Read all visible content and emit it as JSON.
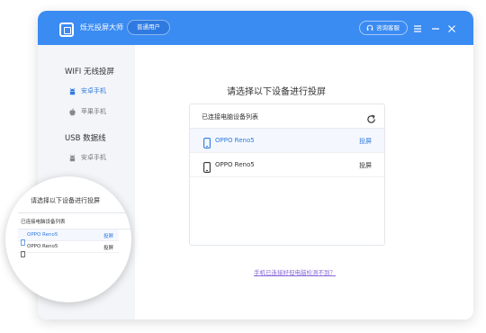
{
  "titlebar": {
    "app_title": "烁光投屏大师",
    "user_badge": "普通用户",
    "support_label": "咨询客服"
  },
  "sidebar": {
    "wifi_section": "WIFI 无线投屏",
    "wifi_items": [
      {
        "label": "安卓手机",
        "icon": "android-icon",
        "active": true
      },
      {
        "label": "苹果手机",
        "icon": "apple-icon",
        "active": false
      }
    ],
    "usb_section": "USB 数据线",
    "usb_items": [
      {
        "label": "安卓手机",
        "icon": "android-icon",
        "active": false
      }
    ]
  },
  "main": {
    "title": "请选择以下设备进行投屏",
    "panel_header": "已连接电脑设备列表",
    "devices": [
      {
        "name": "OPPO Reno5",
        "action": "投屏",
        "selected": true
      },
      {
        "name": "OPPO Reno5",
        "action": "投屏",
        "selected": false
      }
    ],
    "help_link": "手机已连接好但电脑检测不到？"
  },
  "zoom": {
    "title": "请选择以下设备进行投屏",
    "panel_header": "已连接电脑设备列表",
    "devices": [
      {
        "name": "OPPO Reno5",
        "action": "投屏",
        "selected": true
      },
      {
        "name": "OPPO Reno5",
        "action": "投屏",
        "selected": false
      }
    ]
  },
  "colors": {
    "accent": "#3a8bf2",
    "selected_text": "#2f7ae0",
    "help_link": "#8a6ad8",
    "sidebar_bg": "#f3f5f8"
  }
}
